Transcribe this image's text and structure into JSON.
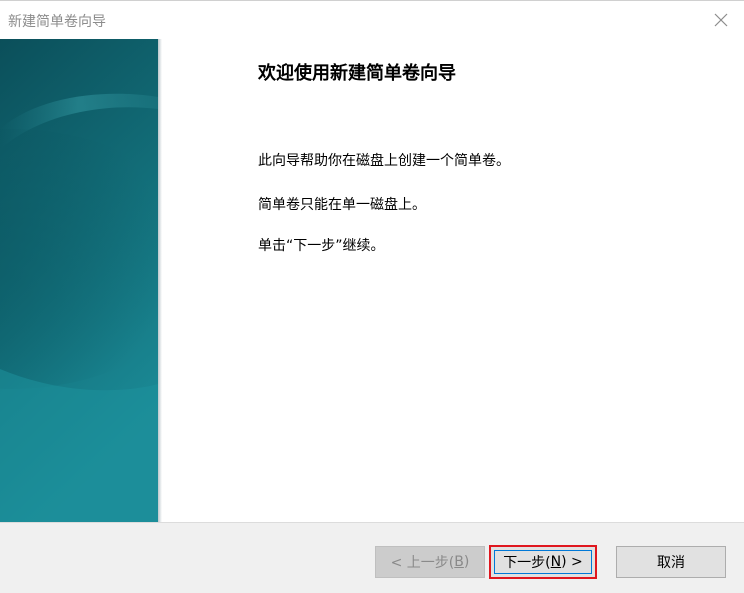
{
  "window": {
    "title": "新建简单卷向导"
  },
  "content": {
    "heading": "欢迎使用新建简单卷向导",
    "paragraph_1": "此向导帮助你在磁盘上创建一个简单卷。",
    "paragraph_2": "简单卷只能在单一磁盘上。",
    "paragraph_3": "单击“下一步”继续。"
  },
  "buttons": {
    "back": {
      "prefix": "< 上一步(",
      "mnemonic": "B",
      "suffix": ")",
      "enabled": false
    },
    "next": {
      "prefix": "下一步(",
      "mnemonic": "N",
      "suffix": ") >",
      "enabled": true
    },
    "cancel": {
      "label": "取消",
      "enabled": true
    }
  },
  "icons": {
    "close": "close-icon"
  },
  "colors": {
    "side_panel_top": "#0e5560",
    "side_panel_bottom": "#1a8a96",
    "highlight_border": "#e0161e",
    "focus_border": "#0078d7",
    "footer_bg": "#f0f0f0"
  }
}
